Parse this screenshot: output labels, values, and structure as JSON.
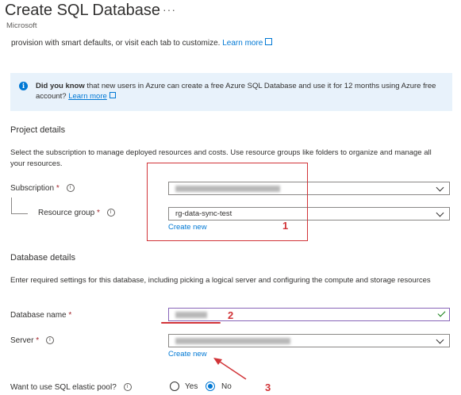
{
  "header": {
    "title": "Create SQL Database",
    "more_icon": "···",
    "publisher": "Microsoft"
  },
  "intro": {
    "text": "provision with smart defaults, or visit each tab to customize.",
    "link": "Learn more"
  },
  "info": {
    "icon": "i",
    "bold": "Did you know",
    "text": " that new users in Azure can create a free Azure SQL Database and use it for 12 months using Azure free account?",
    "link": "Learn more"
  },
  "project": {
    "heading": "Project details",
    "description": "Select the subscription to manage deployed resources and costs. Use resource groups like folders to organize and manage all your resources.",
    "subscription": {
      "label": "Subscription",
      "required": "*",
      "help": "i",
      "value": ""
    },
    "resource_group": {
      "label": "Resource group",
      "required": "*",
      "help": "i",
      "value": "rg-data-sync-test",
      "create_new": "Create new"
    }
  },
  "database": {
    "heading": "Database details",
    "description": "Enter required settings for this database, including picking a logical server and configuring the compute and storage resources",
    "db_name": {
      "label": "Database name",
      "required": "*",
      "value": ""
    },
    "server": {
      "label": "Server",
      "required": "*",
      "help": "i",
      "value": "",
      "create_new": "Create new"
    },
    "elastic_pool": {
      "label": "Want to use SQL elastic pool?",
      "help": "i",
      "options": [
        "Yes",
        "No"
      ],
      "selected": "No"
    }
  },
  "annotations": {
    "one": "1",
    "two": "2",
    "three": "3"
  },
  "colors": {
    "accent": "#0078d4",
    "annotation": "#d13438",
    "info_bg": "#e8f2fb",
    "valid": "#107c10"
  }
}
